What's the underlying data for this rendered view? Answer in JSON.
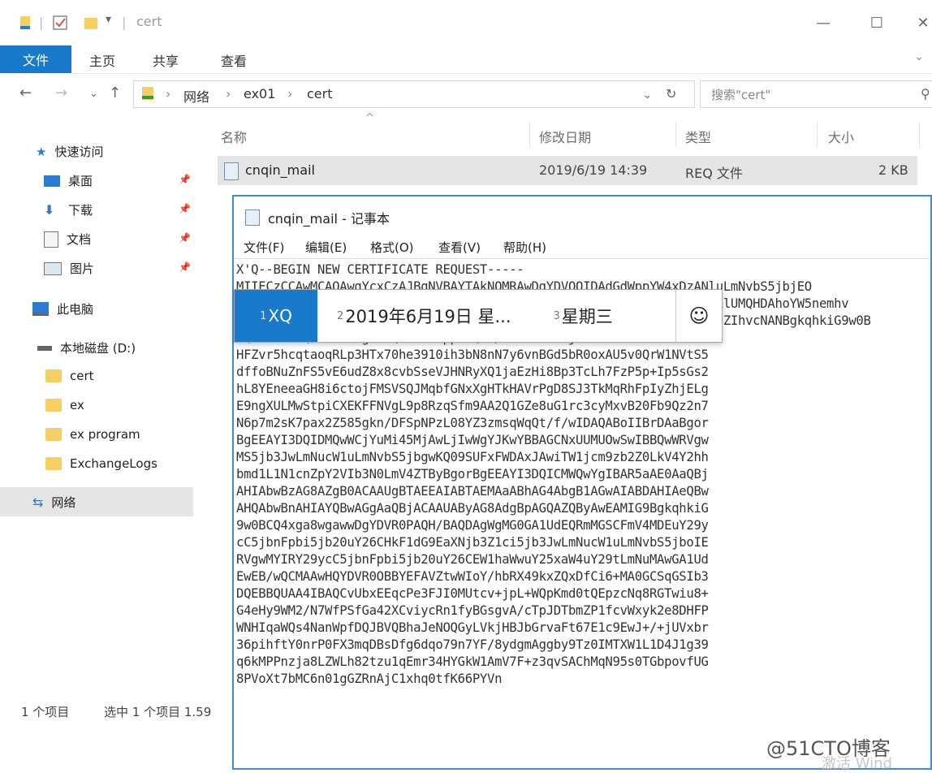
{
  "window": {
    "title": "cert"
  },
  "ribbon": {
    "file": "文件",
    "tabs": [
      "主页",
      "共享",
      "查看"
    ]
  },
  "address": {
    "crumbs": [
      "网络",
      "ex01",
      "cert"
    ],
    "search_placeholder": "搜索\"cert\""
  },
  "nav": {
    "quick_access": "快速访问",
    "pinned": [
      "桌面",
      "下载",
      "文档",
      "图片"
    ],
    "this_pc": "此电脑",
    "local_disk": "本地磁盘 (D:)",
    "folders": [
      "cert",
      "ex",
      "ex program",
      "ExchangeLogs"
    ],
    "network": "网络"
  },
  "file_list": {
    "columns": [
      "名称",
      "修改日期",
      "类型",
      "大小"
    ],
    "rows": [
      {
        "name": "cnqin_mail",
        "modified": "2019/6/19 14:39",
        "type": "REQ 文件",
        "size": "2 KB"
      }
    ]
  },
  "status": {
    "count": "1 个项目",
    "selected": "选中 1 个项目 1.59"
  },
  "notepad": {
    "title": "cnqin_mail - 记事本",
    "menu": [
      "文件(F)",
      "编辑(E)",
      "格式(O)",
      "查看(V)",
      "帮助(H)"
    ],
    "lines": [
      "X'Q--BEGIN NEW CERTIFICATE REQUEST-----",
      "MIIECzCCAwMCAQAwgYcxCzAJBgNVBAYTAkNOMRAwDgYDVQQIDAdGdWppYW4xDzANluLmNvbS5jbjEO",
      "MA0GA1UEBwwGWGlhbWVuMRUwEwYDVQQKDAxDTlFJTiBDby5sdGQxDTALBgNVBAsMBElUMQHDAhoYW5nemhv",
      "dTEkMCIGCSqGSIb3DQEJARYVY2hlbmd6aG91QGNucWluLmNvbS5jbjCCASIwDQYJKoZIhvcNANBgkqhkiG9w0B",
      "AQEFAAOCAQ8AMIIBCgKCAQEA1uH+ppw9QYR/kKSSa0nGXj49YMisFUZAWcRwoK1N",
      "HFZvr5hcqtaoqRLp3HTx70he3910ih3bN8nN7y6vnBGd5bR0oxAU5v0QrW1NVtS5",
      "dffoBNuZnFS5vE6udZ8x8cvbSseVJHNRyXQ1jaEzHi8Bp3TcLh7FzP5p+Ip5sGs2",
      "hL8YEneeaGH8i6ctojFMSVSQJMqbfGNxXgHTkHAVrPgD8SJ3TkMqRhFpIyZhjELg",
      "E9ngXULMwStpiCXEKFFNVgL9p8RzqSfm9AA2Q1GZe8uG1rc3cyMxvB20Fb9Qz2n7",
      "N6p7m2sK7pax2Z585gkn/DFSpNPzL08YZ3zmsqWqQt/f/wIDAQABoIIBrDAaBgor",
      "BgEEAYI3DQIDMQwWCjYuMi45MjAwLjIwWgYJKwYBBAGCNxUUMUOwSwIBBQwWRVgw",
      "MS5jb3JwLmNucW1uLmNvbS5jbgwKQ09SUFxFWDAxJAwiTW1jcm9zb2Z0LkV4Y2hh",
      "bmd1L1N1cnZpY2VIb3N0LmV4ZTByBgorBgEEAYI3DQICMWQwYgIBAR5aAE0AaQBj",
      "AHIAbwBzAG8AZgB0ACAAUgBTAEEAIABTAEMAaABhAG4AbgB1AGwAIABDAHIAeQBw",
      "AHQAbwBnAHIAYQBwAGgAaQBjACAAUAByAG8AdgBpAGQAZQByAwEAMIG9BgkqhkiG",
      "9w0BCQ4xga8wgawwDgYDVR0PAQH/BAQDAgWgMG0GA1UdEQRmMGSCFmV4MDEuY29y",
      "cC5jbnFpbi5jb20uY26CHkF1dG9EaXNjb3Z1ci5jb3JwLmNucW1uLmNvbS5jboIE",
      "RVgwMYIRY29ycC5jbnFpbi5jb20uY26CEW1haWwuY25xaW4uY29tLmNuMAwGA1Ud",
      "EwEB/wQCMAAwHQYDVR0OBBYEFAVZtwWIoY/hbRX49kxZQxDfCi6+MA0GCSqGSIb3",
      "DQEBBQUAA4IBAQCvUbxEEqcPe3FJI0MUtcv+jpL+WQpKmd0tQEpzcNq8RGTwiu8+",
      "G4eHy9WM2/N7WfPSfGa42XCviycRn1fyBGsgvA/cTpJDTbmZP1fcvWxyk2e8DHFP",
      "WNHIqaWQs4NanWpfDQJBVQBhaJeNOQGyLVkjHBJbGrvaFt67E1c9EwJ+/+jUVxbr",
      "36pihftY0nrP0FX3mqDBsDfg6dqo79n7YF/8ydgmAggby9Tz0IMTXW1L1D4J1g39",
      "q6kMPPnzja8LZWLh82tzu1qEmr34HYGkW1AmV7F+z3qvSAChMqN95s0TGbpovfUG",
      "8PVoXt7bMC6n01gGZRnAjC1xhq0tfK66PYVn"
    ]
  },
  "ime": {
    "candidates": [
      {
        "num": "1",
        "text": "XQ"
      },
      {
        "num": "2",
        "text": "2019年6月19日 星..."
      },
      {
        "num": "3",
        "text": "星期三"
      }
    ],
    "emoji": "☺"
  },
  "watermark": "@51CTO博客",
  "activation": "激活 Wind"
}
